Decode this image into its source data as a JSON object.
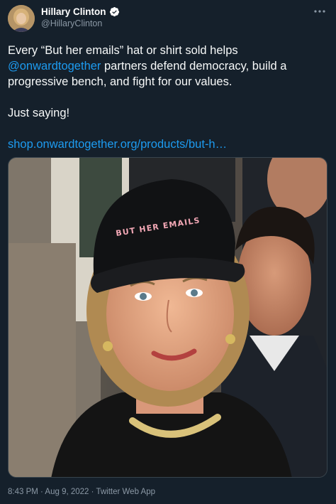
{
  "author": {
    "name": "Hillary Clinton",
    "handle": "@HillaryClinton",
    "verified": true
  },
  "tweet": {
    "line1": "Every “But her emails” hat or shirt sold helps",
    "mention": "@onwardtogether",
    "line2_rest": " partners defend democracy, build a",
    "line3": "progressive bench, and fight for our values.",
    "line4": "Just saying!",
    "link": "shop.onwardtogether.org/products/but-h…",
    "photo_cap_text": "BUT HER EMAILS"
  },
  "meta": {
    "time": "8:43 PM",
    "date": "Aug 9, 2022",
    "source": "Twitter Web App",
    "separator": " · "
  },
  "colors": {
    "background": "#15202b",
    "link": "#1d9bf0",
    "secondary_text": "#8b98a5",
    "verified_badge": "#ffffff"
  },
  "icons": {
    "more": "more-horizontal-icon",
    "verified": "verified-badge-icon"
  }
}
